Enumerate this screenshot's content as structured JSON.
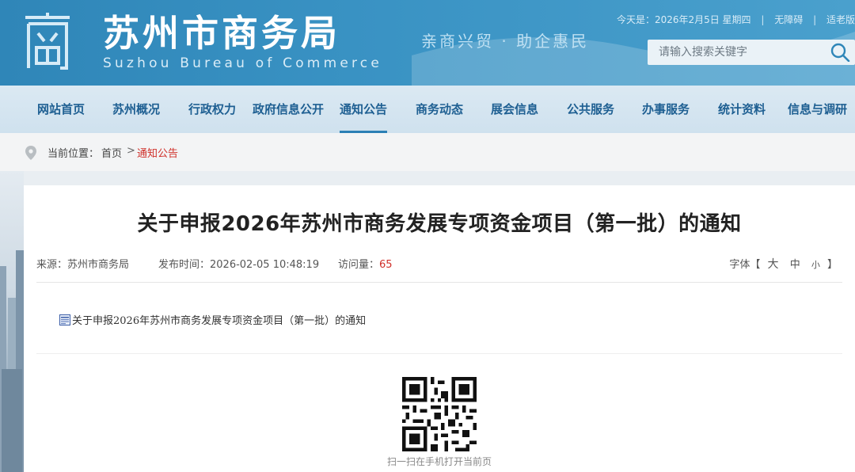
{
  "header": {
    "site_name": "苏州市商务局",
    "site_name_en": "Suzhou Bureau of Commerce",
    "slogan": "亲商兴贸 · 助企惠民",
    "date_text": "今天是：2026年2月5日 星期四",
    "accessibility_link": "无障碍",
    "elderly_link": "适老版",
    "search_placeholder": "请输入搜索关键字",
    "colors": {
      "header_bg": "#3a93c4",
      "nav_text": "#1e5f92",
      "accent_red": "#d0302a"
    }
  },
  "nav": {
    "items": [
      {
        "label": "网站首页"
      },
      {
        "label": "苏州概况"
      },
      {
        "label": "行政权力"
      },
      {
        "label": "政府信息公开"
      },
      {
        "label": "通知公告",
        "active": true
      },
      {
        "label": "商务动态"
      },
      {
        "label": "展会信息"
      },
      {
        "label": "公共服务"
      },
      {
        "label": "办事服务"
      },
      {
        "label": "统计资料"
      },
      {
        "label": "信息与调研"
      }
    ]
  },
  "breadcrumb": {
    "label": "当前位置：",
    "home": "首页",
    "separator": ">",
    "current": "通知公告"
  },
  "article": {
    "title": "关于申报2026年苏州市商务发展专项资金项目（第一批）的通知",
    "source_label": "来源：",
    "source": "苏州市商务局",
    "publish_label": "发布时间：",
    "publish_time": "2026-02-05 10:48:19",
    "views_label": "访问量：",
    "views": "65",
    "font_label": "字体【",
    "font_large": "大",
    "font_medium": "中",
    "font_small": "小",
    "font_end": "】",
    "attachment": "关于申报2026年苏州市商务发展专项资金项目（第一批）的通知",
    "qr_caption": "扫一扫在手机打开当前页"
  }
}
